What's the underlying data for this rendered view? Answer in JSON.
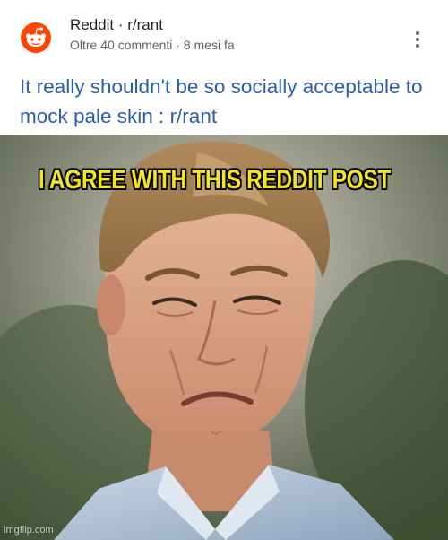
{
  "search_result": {
    "site_name": "Reddit · r/rant",
    "meta": "Oltre 40 commenti · 8 mesi fa",
    "title": "It really shouldn't be so socially acceptable to mock pale skin : r/rant",
    "logo_icon": "reddit-alien-icon",
    "more_icon": "more-vertical-icon",
    "colors": {
      "title": "#2a5db0",
      "logo_bg": "#ff4500"
    }
  },
  "meme": {
    "caption": "I AGREE WITH THIS REDDIT POST",
    "caption_color": "#f5e61b",
    "watermark": "imgflip.com"
  }
}
